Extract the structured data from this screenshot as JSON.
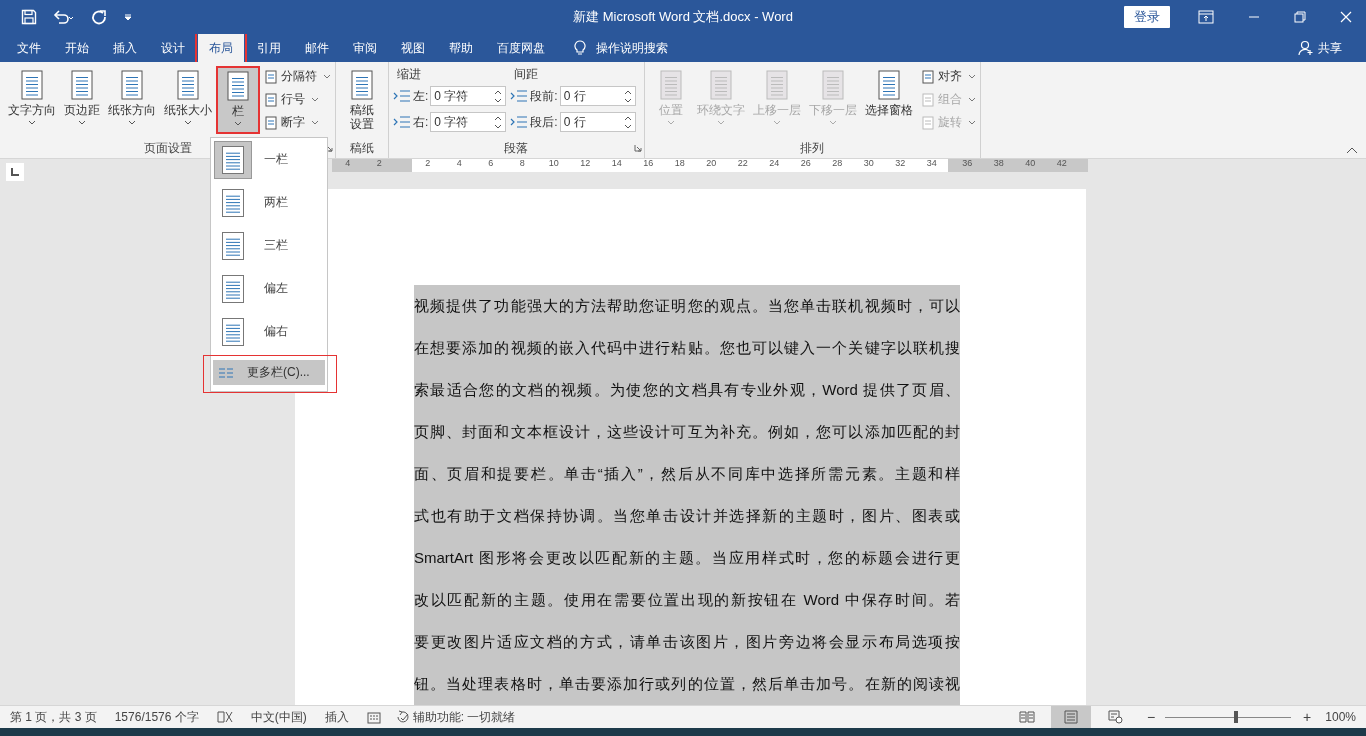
{
  "window": {
    "title": "新建 Microsoft Word 文档.docx  -  Word",
    "signin": "登录"
  },
  "tabs": [
    {
      "label": "文件",
      "selected": false,
      "annotated": false
    },
    {
      "label": "开始",
      "selected": false,
      "annotated": false
    },
    {
      "label": "插入",
      "selected": false,
      "annotated": false
    },
    {
      "label": "设计",
      "selected": false,
      "annotated": false
    },
    {
      "label": "布局",
      "selected": true,
      "annotated": true
    },
    {
      "label": "引用",
      "selected": false,
      "annotated": false
    },
    {
      "label": "邮件",
      "selected": false,
      "annotated": false
    },
    {
      "label": "审阅",
      "selected": false,
      "annotated": false
    },
    {
      "label": "视图",
      "selected": false,
      "annotated": false
    },
    {
      "label": "帮助",
      "selected": false,
      "annotated": false
    },
    {
      "label": "百度网盘",
      "selected": false,
      "annotated": false
    }
  ],
  "tell_me": "操作说明搜索",
  "share": "共享",
  "ribbon": {
    "groups": [
      {
        "kind": "buttons",
        "label": "页面设置",
        "launcher": true,
        "large_buttons": [
          {
            "label": "文字方向",
            "disabled": false,
            "selected": false,
            "annotated": false,
            "caret": true
          },
          {
            "label": "页边距",
            "disabled": false,
            "selected": false,
            "annotated": false,
            "caret": true
          },
          {
            "label": "纸张方向",
            "disabled": false,
            "selected": false,
            "annotated": false,
            "caret": true
          },
          {
            "label": "纸张大小",
            "disabled": false,
            "selected": false,
            "annotated": false,
            "caret": true
          },
          {
            "label": "栏",
            "disabled": false,
            "selected": true,
            "annotated": true,
            "caret": true
          }
        ],
        "small_buttons": [
          {
            "label": "分隔符",
            "disabled": false
          },
          {
            "label": "行号",
            "disabled": false
          },
          {
            "label": "断字",
            "disabled": false
          }
        ]
      },
      {
        "kind": "buttons",
        "label": "稿纸",
        "launcher": false,
        "large_buttons": [
          {
            "label": "稿纸设置",
            "disabled": false,
            "selected": false,
            "annotated": false,
            "caret": false,
            "wrap": true
          }
        ]
      },
      {
        "kind": "paragraph",
        "label": "段落",
        "launcher": true,
        "indent": {
          "title": "缩进",
          "fields": [
            {
              "label": "左:",
              "value": "0 字符"
            },
            {
              "label": "右:",
              "value": "0 字符"
            }
          ]
        },
        "spacing": {
          "title": "间距",
          "fields": [
            {
              "label": "段前:",
              "value": "0 行"
            },
            {
              "label": "段后:",
              "value": "0 行"
            }
          ]
        }
      },
      {
        "kind": "buttons",
        "label": "排列",
        "launcher": false,
        "large_buttons": [
          {
            "label": "位置",
            "disabled": true,
            "selected": false,
            "annotated": false,
            "caret": true
          },
          {
            "label": "环绕文字",
            "disabled": true,
            "selected": false,
            "annotated": false,
            "caret": true
          },
          {
            "label": "上移一层",
            "disabled": true,
            "selected": false,
            "annotated": false,
            "caret": true
          },
          {
            "label": "下移一层",
            "disabled": true,
            "selected": false,
            "annotated": false,
            "caret": true
          },
          {
            "label": "选择窗格",
            "disabled": false,
            "selected": false,
            "annotated": false,
            "caret": false
          }
        ],
        "small_buttons": [
          {
            "label": "对齐",
            "disabled": false
          },
          {
            "label": "组合",
            "disabled": true
          },
          {
            "label": "旋转",
            "disabled": true
          }
        ]
      }
    ]
  },
  "columns_menu": {
    "items": [
      {
        "label": "一栏",
        "selected": true
      },
      {
        "label": "两栏",
        "selected": false
      },
      {
        "label": "三栏",
        "selected": false
      },
      {
        "label": "偏左",
        "selected": false
      },
      {
        "label": "偏右",
        "selected": false
      }
    ],
    "more": {
      "label": "更多栏(C)...",
      "annotated": true
    }
  },
  "ruler": {
    "left_numbers": [
      "4",
      "2"
    ],
    "numbers": [
      "2",
      "4",
      "6",
      "8",
      "10",
      "12",
      "14",
      "16",
      "18",
      "20",
      "22",
      "24",
      "26",
      "28",
      "30",
      "32",
      "34"
    ],
    "right_numbers": [
      "36",
      "38",
      "40",
      "42"
    ]
  },
  "document": {
    "lines": [
      "视频提供了功能强大的方法帮助您证明您的观点。当您单击联机视频时，可以",
      "在想要添加的视频的嵌入代码中进行粘贴。您也可以键入一个关键字以联机搜",
      "索最适合您的文档的视频。为使您的文档具有专业外观，Word 提供了页眉、",
      "页脚、封面和文本框设计，这些设计可互为补充。例如，您可以添加匹配的封",
      "面、页眉和提要栏。单击“插入”，然后从不同库中选择所需元素。主题和样",
      "式也有助于文档保持协调。当您单击设计并选择新的主题时，图片、图表或",
      "SmartArt 图形将会更改以匹配新的主题。当应用样式时，您的标题会进行更",
      "改以匹配新的主题。使用在需要位置出现的新按钮在 Word 中保存时间。若",
      "要更改图片适应文档的方式，请单击该图片，图片旁边将会显示布局选项按",
      "钮。当处理表格时，单击要添加行或列的位置，然后单击加号。在新的阅读视"
    ]
  },
  "status_bar": {
    "page": "第 1 页，共 3 页",
    "words": "1576/1576 个字",
    "language": "中文(中国)",
    "mode": "插入",
    "accessibility": "辅助功能: 一切就绪",
    "views": [
      {
        "selected": false
      },
      {
        "selected": true
      },
      {
        "selected": false
      }
    ],
    "zoom": {
      "minus": "−",
      "level": 0.55,
      "plus": "+",
      "percent": "100%"
    }
  }
}
